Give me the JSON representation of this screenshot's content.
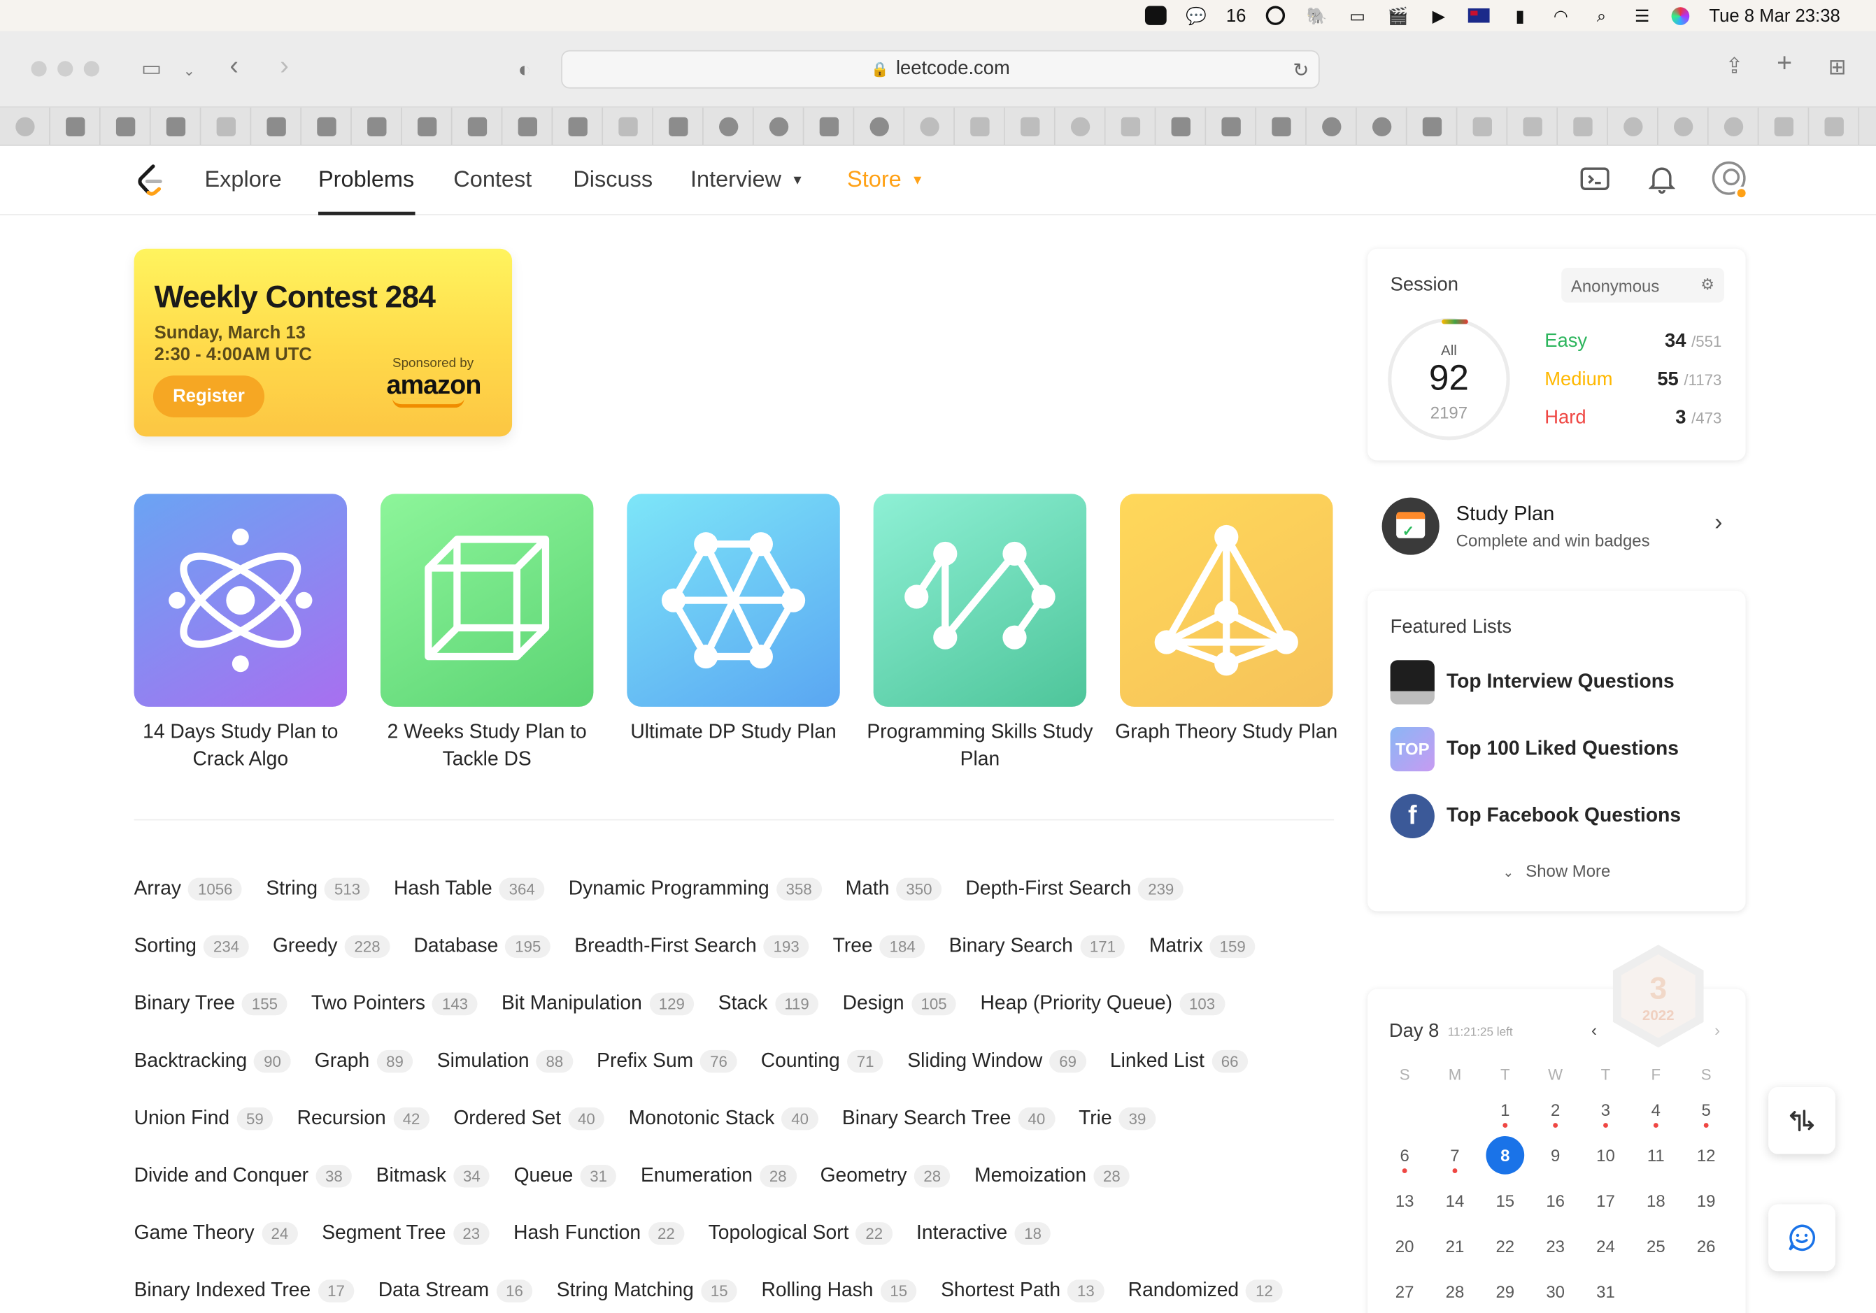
{
  "menubar": {
    "wechat_count": "16",
    "datetime": "Tue 8 Mar  23:38"
  },
  "browser": {
    "url": "leetcode.com"
  },
  "nav": {
    "links": [
      "Explore",
      "Problems",
      "Contest",
      "Discuss",
      "Interview",
      "Store"
    ],
    "active": "Problems"
  },
  "contest": {
    "title": "Weekly Contest 284",
    "date": "Sunday, March 13",
    "time": "2:30 - 4:00AM UTC",
    "register_label": "Register",
    "sponsored_label": "Sponsored by",
    "sponsor": "amazon"
  },
  "study_plans": [
    {
      "title": "14 Days Study Plan to Crack Algo",
      "icon": "atom-icon",
      "color_from": "#6aa4f3",
      "color_to": "#a86ff0"
    },
    {
      "title": "2 Weeks Study Plan to Tackle DS",
      "icon": "cube-icon",
      "color_from": "#8df59a",
      "color_to": "#5cd474"
    },
    {
      "title": "Ultimate DP Study Plan",
      "icon": "graph-hex-icon",
      "color_from": "#7de6f8",
      "color_to": "#5aa6f2"
    },
    {
      "title": "Programming Skills Study Plan",
      "icon": "zigzag-nodes-icon",
      "color_from": "#8ef0d5",
      "color_to": "#4ec59a"
    },
    {
      "title": "Graph Theory Study Plan",
      "icon": "triangle-graph-icon",
      "color_from": "#ffd85a",
      "color_to": "#f6c25a"
    }
  ],
  "tags": [
    [
      [
        "Array",
        "1056"
      ],
      [
        "String",
        "513"
      ],
      [
        "Hash Table",
        "364"
      ],
      [
        "Dynamic Programming",
        "358"
      ],
      [
        "Math",
        "350"
      ],
      [
        "Depth-First Search",
        "239"
      ]
    ],
    [
      [
        "Sorting",
        "234"
      ],
      [
        "Greedy",
        "228"
      ],
      [
        "Database",
        "195"
      ],
      [
        "Breadth-First Search",
        "193"
      ],
      [
        "Tree",
        "184"
      ],
      [
        "Binary Search",
        "171"
      ],
      [
        "Matrix",
        "159"
      ]
    ],
    [
      [
        "Binary Tree",
        "155"
      ],
      [
        "Two Pointers",
        "143"
      ],
      [
        "Bit Manipulation",
        "129"
      ],
      [
        "Stack",
        "119"
      ],
      [
        "Design",
        "105"
      ],
      [
        "Heap (Priority Queue)",
        "103"
      ]
    ],
    [
      [
        "Backtracking",
        "90"
      ],
      [
        "Graph",
        "89"
      ],
      [
        "Simulation",
        "88"
      ],
      [
        "Prefix Sum",
        "76"
      ],
      [
        "Counting",
        "71"
      ],
      [
        "Sliding Window",
        "69"
      ],
      [
        "Linked List",
        "66"
      ]
    ],
    [
      [
        "Union Find",
        "59"
      ],
      [
        "Recursion",
        "42"
      ],
      [
        "Ordered Set",
        "40"
      ],
      [
        "Monotonic Stack",
        "40"
      ],
      [
        "Binary Search Tree",
        "40"
      ],
      [
        "Trie",
        "39"
      ]
    ],
    [
      [
        "Divide and Conquer",
        "38"
      ],
      [
        "Bitmask",
        "34"
      ],
      [
        "Queue",
        "31"
      ],
      [
        "Enumeration",
        "28"
      ],
      [
        "Geometry",
        "28"
      ],
      [
        "Memoization",
        "28"
      ]
    ],
    [
      [
        "Game Theory",
        "24"
      ],
      [
        "Segment Tree",
        "23"
      ],
      [
        "Hash Function",
        "22"
      ],
      [
        "Topological Sort",
        "22"
      ],
      [
        "Interactive",
        "18"
      ]
    ],
    [
      [
        "Binary Indexed Tree",
        "17"
      ],
      [
        "Data Stream",
        "16"
      ],
      [
        "String Matching",
        "15"
      ],
      [
        "Rolling Hash",
        "15"
      ],
      [
        "Shortest Path",
        "13"
      ],
      [
        "Randomized",
        "12"
      ]
    ]
  ],
  "session": {
    "title": "Session",
    "select": "Anonymous",
    "all_label": "All",
    "solved": "92",
    "total": "2197",
    "easy": {
      "label": "Easy",
      "solved": "34",
      "total": "/551",
      "color": "#2db55d"
    },
    "medium": {
      "label": "Medium",
      "solved": "55",
      "total": "/1173",
      "color": "#ffb800"
    },
    "hard": {
      "label": "Hard",
      "solved": "3",
      "total": "/473",
      "color": "#ef4743"
    }
  },
  "study_plan_link": {
    "title": "Study Plan",
    "subtitle": "Complete and win badges"
  },
  "featured": {
    "title": "Featured Lists",
    "items": [
      "Top Interview Questions",
      "Top 100 Liked Questions",
      "Top Facebook Questions"
    ],
    "top_badge": "TOP",
    "fb_letter": "f",
    "show_more": "Show More"
  },
  "calendar": {
    "day_label": "Day 8",
    "time_left": "11:21:25 left",
    "badge_number": "3",
    "badge_year": "2022",
    "weekdays": [
      "S",
      "M",
      "T",
      "W",
      "T",
      "F",
      "S"
    ],
    "weeks": [
      [
        "",
        "",
        "1",
        "2",
        "3",
        "4",
        "5"
      ],
      [
        "6",
        "7",
        "8",
        "9",
        "10",
        "11",
        "12"
      ],
      [
        "13",
        "14",
        "15",
        "16",
        "17",
        "18",
        "19"
      ],
      [
        "20",
        "21",
        "22",
        "23",
        "24",
        "25",
        "26"
      ],
      [
        "27",
        "28",
        "29",
        "30",
        "31",
        "",
        ""
      ]
    ],
    "today": "8",
    "dotted_days": [
      "1",
      "2",
      "3",
      "4",
      "5",
      "6",
      "7"
    ]
  }
}
